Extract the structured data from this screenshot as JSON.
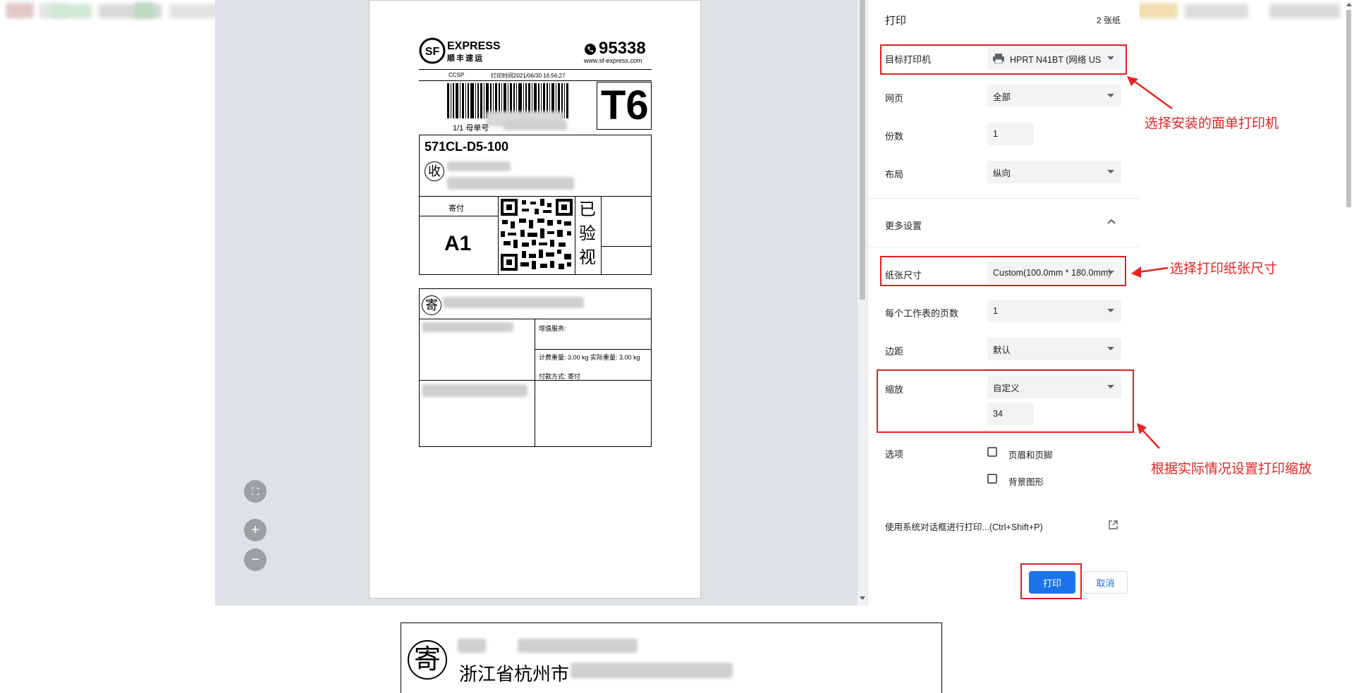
{
  "label": {
    "brand_name": "EXPRESS",
    "brand_cn": "顺丰速运",
    "hotline": "95338",
    "website": "www.sf-express.com",
    "ccsp": "CCSP",
    "print_time": "打印时间2021/06/30 16:56:27",
    "tracking_prefix": "1/1  母单号",
    "zone_code": "T6",
    "route_code": "571CL-D5-100",
    "recipient_mark": "收",
    "payment_header": "寄付",
    "area_code": "A1",
    "inspected": [
      "已",
      "验",
      "视"
    ],
    "sender_mark": "寄",
    "value_added": "增值服务:",
    "weight_info": "计费重量: 3.00 kg   实际重量: 3.00 kg",
    "payment_method": "付款方式: 寄付"
  },
  "preview_controls": {
    "fit_icon": "fit-to-page-icon",
    "zoom_in": "+",
    "zoom_out": "−"
  },
  "settings": {
    "title": "打印",
    "sheet_count": "2 张纸",
    "destination_label": "目标打印机",
    "destination_value": "HPRT N41BT (网络 US",
    "pages_label": "网页",
    "pages_value": "全部",
    "copies_label": "份数",
    "copies_value": "1",
    "layout_label": "布局",
    "layout_value": "纵向",
    "more_settings": "更多设置",
    "paper_size_label": "纸张尺寸",
    "paper_size_value": "Custom(100.0mm * 180.0mm)",
    "pages_per_sheet_label": "每个工作表的页数",
    "pages_per_sheet_value": "1",
    "margins_label": "边距",
    "margins_value": "默认",
    "scale_label": "缩放",
    "scale_value": "自定义",
    "scale_number": "34",
    "options_label": "选项",
    "option_headers": "页眉和页脚",
    "option_background": "背景图形",
    "system_dialog": "使用系统对话框进行打印...(Ctrl+Shift+P)",
    "print_button": "打印",
    "cancel_button": "取消"
  },
  "annotations": {
    "printer": "选择安装的面单打印机",
    "paper_size": "选择打印纸张尺寸",
    "scale": "根据实际情况设置打印缩放"
  },
  "below": {
    "sender_mark": "寄",
    "address_start": "浙江省杭州市"
  },
  "colors": {
    "accent": "#1a73e8",
    "annotation": "#e82323",
    "preview_bg": "#dee1e6"
  }
}
